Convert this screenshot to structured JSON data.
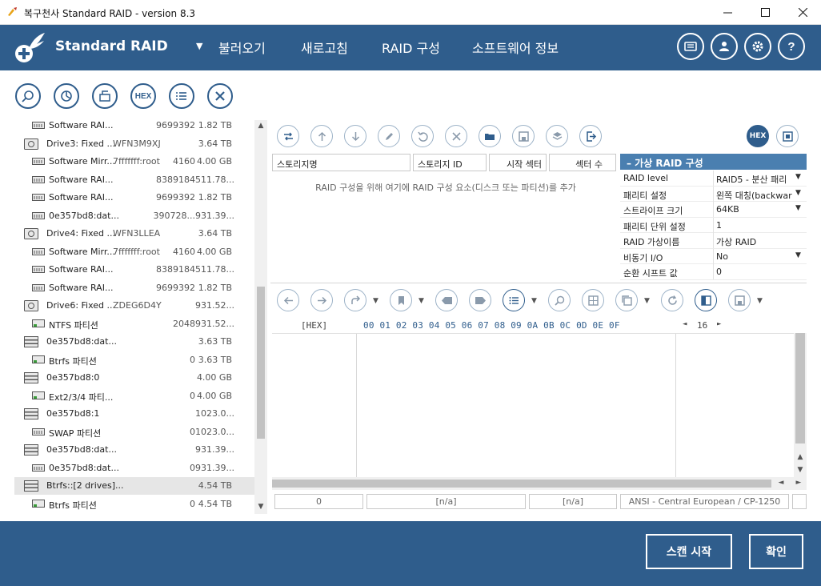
{
  "window": {
    "title": "복구천사 Standard RAID - version 8.3"
  },
  "header": {
    "brand": "Standard RAID",
    "menu": [
      "불러오기",
      "새로고침",
      "RAID 구성",
      "소프트웨어 정보"
    ]
  },
  "left_toolbar": {
    "hex_label": "HEX"
  },
  "tree": {
    "rows": [
      {
        "type": "partition",
        "name": "Software RAI...",
        "id": "",
        "sectors": "9699392",
        "size": "1.82 TB",
        "indent": 1
      },
      {
        "type": "drive",
        "name": "Drive3: Fixed ...",
        "id": "WFN3M9XJ",
        "sectors": "",
        "size": "3.64 TB",
        "indent": 0
      },
      {
        "type": "partition",
        "name": "Software Mirr...",
        "id": "7fffffff:root",
        "sectors": "4160",
        "size": "4.00 GB",
        "indent": 1
      },
      {
        "type": "partition",
        "name": "Software RAI...",
        "id": "",
        "sectors": "8389184",
        "size": "511.78...",
        "indent": 1
      },
      {
        "type": "partition",
        "name": "Software RAI...",
        "id": "",
        "sectors": "9699392",
        "size": "1.82 TB",
        "indent": 1
      },
      {
        "type": "partition",
        "name": "0e357bd8:dat...",
        "id": "",
        "sectors": "390728...",
        "size": "931.39...",
        "indent": 1
      },
      {
        "type": "drive",
        "name": "Drive4: Fixed ...",
        "id": "WFN3LLEA",
        "sectors": "",
        "size": "3.64 TB",
        "indent": 0
      },
      {
        "type": "partition",
        "name": "Software Mirr...",
        "id": "7fffffff:root",
        "sectors": "4160",
        "size": "4.00 GB",
        "indent": 1
      },
      {
        "type": "partition",
        "name": "Software RAI...",
        "id": "",
        "sectors": "8389184",
        "size": "511.78...",
        "indent": 1
      },
      {
        "type": "partition",
        "name": "Software RAI...",
        "id": "",
        "sectors": "9699392",
        "size": "1.82 TB",
        "indent": 1
      },
      {
        "type": "drive",
        "name": "Drive6: Fixed ...",
        "id": "ZDEG6D4Y",
        "sectors": "",
        "size": "931.52...",
        "indent": 0
      },
      {
        "type": "fs",
        "name": "NTFS 파티션",
        "id": "",
        "sectors": "2048",
        "size": "931.52...",
        "indent": 1
      },
      {
        "type": "raid",
        "name": "0e357bd8:dat...",
        "id": "",
        "sectors": "",
        "size": "3.63 TB",
        "indent": 0
      },
      {
        "type": "fs",
        "name": "Btrfs 파티션",
        "id": "",
        "sectors": "0",
        "size": "3.63 TB",
        "indent": 1
      },
      {
        "type": "raid",
        "name": "0e357bd8:0",
        "id": "",
        "sectors": "",
        "size": "4.00 GB",
        "indent": 0
      },
      {
        "type": "fs",
        "name": "Ext2/3/4 파티...",
        "id": "",
        "sectors": "0",
        "size": "4.00 GB",
        "indent": 1
      },
      {
        "type": "raid",
        "name": "0e357bd8:1",
        "id": "",
        "sectors": "",
        "size": "1023.0...",
        "indent": 0
      },
      {
        "type": "partition",
        "name": "SWAP 파티션",
        "id": "",
        "sectors": "0",
        "size": "1023.0...",
        "indent": 1
      },
      {
        "type": "raid",
        "name": "0e357bd8:dat...",
        "id": "",
        "sectors": "",
        "size": "931.39...",
        "indent": 0
      },
      {
        "type": "partition",
        "name": "0e357bd8:dat...",
        "id": "",
        "sectors": "0",
        "size": "931.39...",
        "indent": 1
      },
      {
        "type": "raid",
        "name": "Btrfs::[2 drives]...",
        "id": "",
        "sectors": "",
        "size": "4.54 TB",
        "indent": 0,
        "selected": true
      },
      {
        "type": "fs",
        "name": "Btrfs 파티션",
        "id": "",
        "sectors": "0",
        "size": "4.54 TB",
        "indent": 1
      }
    ]
  },
  "raid_toolbar": {
    "hex_label": "HEX"
  },
  "storage_table": {
    "columns": [
      "스토리지명",
      "스토리지 ID",
      "시작 섹터",
      "섹터 수"
    ],
    "hint": "RAID 구성을 위해 여기에 RAID 구성 요소(디스크 또는 파티션)를 추가"
  },
  "virtual_raid": {
    "title": "–   가상 RAID 구성",
    "props": [
      {
        "key": "RAID level",
        "value": "RAID5 - 분산 패리",
        "dropdown": true
      },
      {
        "key": "패리티 설정",
        "value": "왼쪽 대칭(backwar",
        "dropdown": true
      },
      {
        "key": "스트라이프 크기",
        "value": "64KB",
        "dropdown": true
      },
      {
        "key": "패리티 단위 설정",
        "value": "1",
        "dropdown": false
      },
      {
        "key": "RAID 가상이름",
        "value": "가상 RAID",
        "dropdown": false
      },
      {
        "key": "비동기 I/O",
        "value": "No",
        "dropdown": true
      },
      {
        "key": "순환 시프트 값",
        "value": "0",
        "dropdown": false
      }
    ]
  },
  "hex_view": {
    "label": "[HEX]",
    "offsets": "00 01 02 03 04 05 06 07 08 09 0A 0B 0C 0D 0E 0F",
    "width": "16"
  },
  "status_bar": {
    "offset": "0",
    "field2": "[n/a]",
    "field3": "[n/a]",
    "encoding": "ANSI - Central European / CP-1250"
  },
  "footer": {
    "scan_button": "스캔 시작",
    "ok_button": "확인"
  },
  "colors": {
    "brand": "#2f5d8c",
    "panel_header": "#4a7fb0"
  }
}
